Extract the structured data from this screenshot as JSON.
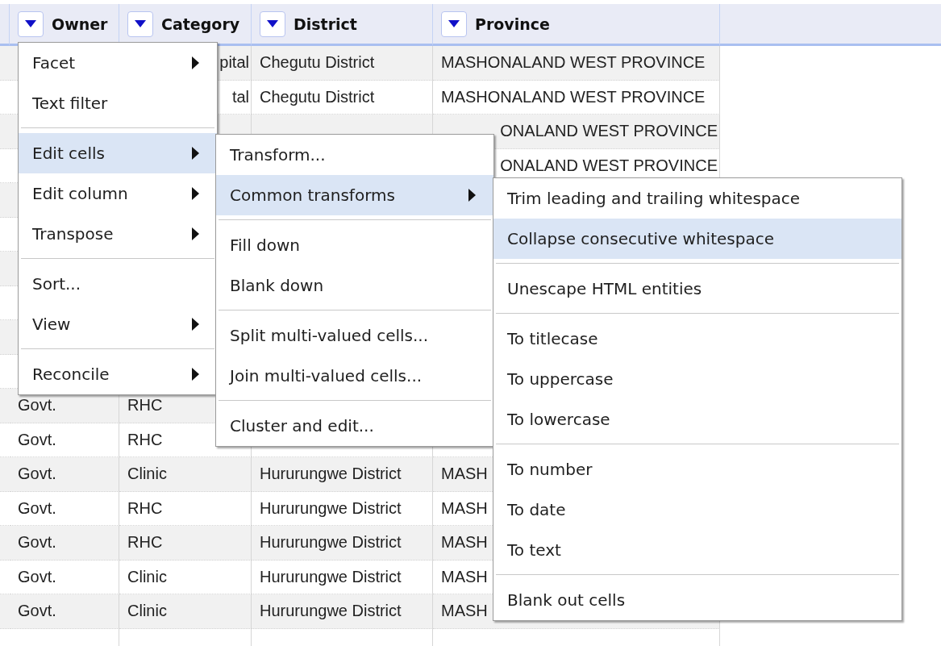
{
  "table": {
    "columns": [
      {
        "label": "Owner"
      },
      {
        "label": "Category"
      },
      {
        "label": "District"
      },
      {
        "label": "Province"
      }
    ],
    "rows": [
      {
        "cells": [
          null,
          {
            "text": "pital",
            "cut_left": true
          },
          {
            "text": "Chegutu District"
          },
          {
            "text": "MASHONALAND WEST PROVINCE"
          }
        ]
      },
      {
        "cells": [
          null,
          {
            "text": "tal",
            "cut_left": true
          },
          {
            "text": "Chegutu District"
          },
          {
            "text": "MASHONALAND WEST PROVINCE"
          }
        ]
      },
      {
        "cells": [
          null,
          null,
          null,
          {
            "text": "ONALAND WEST PROVINCE",
            "cut_left": true
          }
        ]
      },
      {
        "cells": [
          null,
          null,
          null,
          {
            "text": "ONALAND WEST PROVINCE",
            "cut_left": true
          }
        ]
      },
      {
        "cells": [
          null,
          null,
          null,
          null
        ]
      },
      {
        "cells": [
          null,
          null,
          null,
          null
        ]
      },
      {
        "cells": [
          null,
          null,
          null,
          null
        ]
      },
      {
        "cells": [
          null,
          null,
          null,
          null
        ]
      },
      {
        "cells": [
          null,
          null,
          null,
          null
        ]
      },
      {
        "cells": [
          null,
          null,
          null,
          null
        ]
      },
      {
        "cells": [
          {
            "text": "Govt."
          },
          {
            "text": "RHC"
          },
          null,
          null
        ]
      },
      {
        "cells": [
          {
            "text": "Govt."
          },
          {
            "text": "RHC"
          },
          null,
          null
        ]
      },
      {
        "cells": [
          {
            "text": "Govt."
          },
          {
            "text": "Clinic"
          },
          {
            "text": "Hururungwe District"
          },
          {
            "text": "MASH"
          }
        ]
      },
      {
        "cells": [
          {
            "text": "Govt."
          },
          {
            "text": "RHC"
          },
          {
            "text": "Hururungwe District"
          },
          {
            "text": "MASH"
          }
        ]
      },
      {
        "cells": [
          {
            "text": "Govt."
          },
          {
            "text": "RHC"
          },
          {
            "text": "Hururungwe District"
          },
          {
            "text": "MASH"
          }
        ]
      },
      {
        "cells": [
          {
            "text": "Govt."
          },
          {
            "text": "Clinic"
          },
          {
            "text": "Hururungwe District"
          },
          {
            "text": "MASH"
          }
        ]
      },
      {
        "cells": [
          {
            "text": "Govt."
          },
          {
            "text": "Clinic"
          },
          {
            "text": "Hururungwe District"
          },
          {
            "text": "MASH"
          }
        ]
      },
      {
        "cells": [
          null,
          null,
          null,
          null
        ]
      }
    ]
  },
  "menus": [
    {
      "items": [
        {
          "kind": "item",
          "label": "Facet",
          "has_submenu": true,
          "selected": false
        },
        {
          "kind": "item",
          "label": "Text filter",
          "has_submenu": false,
          "selected": false
        },
        {
          "kind": "separator"
        },
        {
          "kind": "item",
          "label": "Edit cells",
          "has_submenu": true,
          "selected": true
        },
        {
          "kind": "item",
          "label": "Edit column",
          "has_submenu": true,
          "selected": false
        },
        {
          "kind": "item",
          "label": "Transpose",
          "has_submenu": true,
          "selected": false
        },
        {
          "kind": "separator"
        },
        {
          "kind": "item",
          "label": "Sort...",
          "has_submenu": false,
          "selected": false
        },
        {
          "kind": "item",
          "label": "View",
          "has_submenu": true,
          "selected": false
        },
        {
          "kind": "separator"
        },
        {
          "kind": "item",
          "label": "Reconcile",
          "has_submenu": true,
          "selected": false
        }
      ]
    },
    {
      "items": [
        {
          "kind": "item",
          "label": "Transform...",
          "has_submenu": false,
          "selected": false
        },
        {
          "kind": "item",
          "label": "Common transforms",
          "has_submenu": true,
          "selected": true
        },
        {
          "kind": "separator"
        },
        {
          "kind": "item",
          "label": "Fill down",
          "has_submenu": false,
          "selected": false
        },
        {
          "kind": "item",
          "label": "Blank down",
          "has_submenu": false,
          "selected": false
        },
        {
          "kind": "separator"
        },
        {
          "kind": "item",
          "label": "Split multi-valued cells...",
          "has_submenu": false,
          "selected": false
        },
        {
          "kind": "item",
          "label": "Join multi-valued cells...",
          "has_submenu": false,
          "selected": false
        },
        {
          "kind": "separator"
        },
        {
          "kind": "item",
          "label": "Cluster and edit...",
          "has_submenu": false,
          "selected": false
        }
      ]
    },
    {
      "items": [
        {
          "kind": "item",
          "label": "Trim leading and trailing whitespace",
          "has_submenu": false,
          "selected": false
        },
        {
          "kind": "item",
          "label": "Collapse consecutive whitespace",
          "has_submenu": false,
          "selected": true
        },
        {
          "kind": "separator"
        },
        {
          "kind": "item",
          "label": "Unescape HTML entities",
          "has_submenu": false,
          "selected": false
        },
        {
          "kind": "separator"
        },
        {
          "kind": "item",
          "label": "To titlecase",
          "has_submenu": false,
          "selected": false
        },
        {
          "kind": "item",
          "label": "To uppercase",
          "has_submenu": false,
          "selected": false
        },
        {
          "kind": "item",
          "label": "To lowercase",
          "has_submenu": false,
          "selected": false
        },
        {
          "kind": "separator"
        },
        {
          "kind": "item",
          "label": "To number",
          "has_submenu": false,
          "selected": false
        },
        {
          "kind": "item",
          "label": "To date",
          "has_submenu": false,
          "selected": false
        },
        {
          "kind": "item",
          "label": "To text",
          "has_submenu": false,
          "selected": false
        },
        {
          "kind": "separator"
        },
        {
          "kind": "item",
          "label": "Blank out cells",
          "has_submenu": false,
          "selected": false
        }
      ]
    }
  ]
}
